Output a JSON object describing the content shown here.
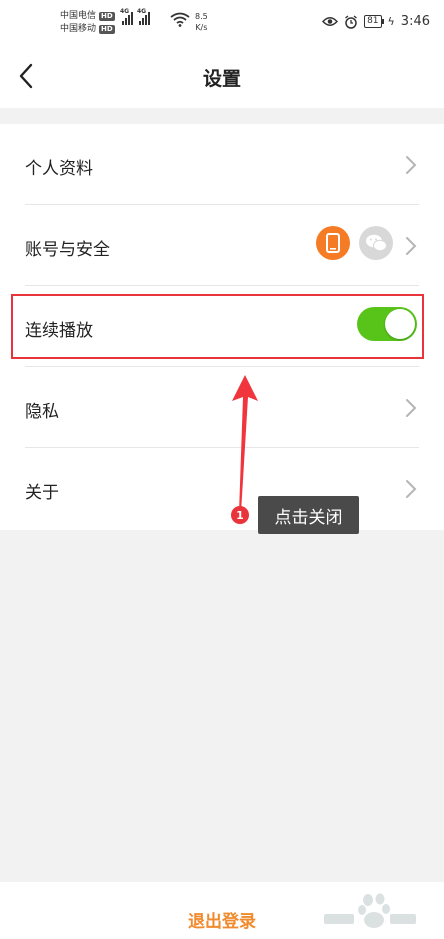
{
  "status_bar": {
    "carrier1": "中国电信",
    "carrier2": "中国移动",
    "hd_label": "HD",
    "network1": "4G",
    "network2": "4G",
    "speed_value": "8.5",
    "speed_unit": "K/s",
    "battery": "81",
    "time": "3:46"
  },
  "nav": {
    "title": "设置"
  },
  "settings": {
    "items": [
      {
        "label": "个人资料"
      },
      {
        "label": "账号与安全"
      },
      {
        "label": "连续播放"
      },
      {
        "label": "隐私"
      },
      {
        "label": "关于"
      }
    ]
  },
  "autoplay_toggle": {
    "on": true
  },
  "annotation": {
    "step": "1",
    "tooltip": "点击关闭"
  },
  "footer": {
    "logout_label": "退出登录"
  },
  "colors": {
    "accent_orange": "#f08a2c",
    "toggle_green": "#58c41a",
    "annotation_red": "#e8343a"
  },
  "icons": {
    "back": "chevron-left-icon",
    "phone": "phone-icon",
    "wechat": "wechat-icon",
    "row_chevron": "chevron-right-icon"
  }
}
